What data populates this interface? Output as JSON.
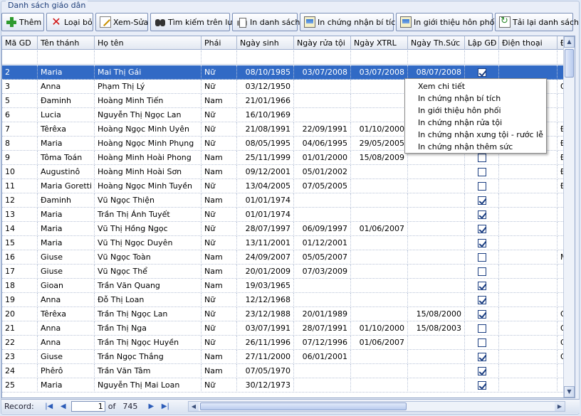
{
  "window": {
    "group_title": "Danh sách giáo dân"
  },
  "toolbar": {
    "buttons": [
      {
        "label": "Thêm",
        "icon": "plus-icon"
      },
      {
        "label": "Loại bỏ",
        "icon": "delete-x-icon"
      },
      {
        "label": "Xem-Sửa",
        "icon": "edit-icon"
      },
      {
        "label": "Tìm kiếm trên lưới",
        "icon": "binoculars-icon"
      },
      {
        "label": "In danh sách",
        "icon": "printer-icon"
      },
      {
        "label": "In chứng nhận bí tích",
        "icon": "certificate-icon"
      },
      {
        "label": "In giới thiệu hôn phối",
        "icon": "certificate-icon"
      },
      {
        "label": "Tải lại danh sách",
        "icon": "reload-icon"
      }
    ]
  },
  "grid": {
    "columns": [
      "Mã GD",
      "Tên thánh",
      "Họ tên",
      "Phái",
      "Ngày sinh",
      "Ngày rửa tội",
      "Ngày XTRL",
      "Ngày Th.Sức",
      "Lập GĐ",
      "Điện thoại",
      "Đ"
    ],
    "rows": [
      {
        "id": "2",
        "saint": "Maria",
        "name": "Mai Thị Gái",
        "sex": "Nữ",
        "dob": "08/10/1985",
        "baptism": "03/07/2008",
        "xtrl": "03/07/2008",
        "thsuc": "08/07/2008",
        "lapgd": true,
        "phone": "",
        "extra": "",
        "selected": true
      },
      {
        "id": "3",
        "saint": "Anna",
        "name": "Phạm Thị Lý",
        "sex": "Nữ",
        "dob": "03/12/1950",
        "baptism": "",
        "xtrl": "",
        "thsuc": "",
        "lapgd": false,
        "phone": "",
        "extra": "G"
      },
      {
        "id": "5",
        "saint": "Đaminh",
        "name": "Hoàng Minh Tiến",
        "sex": "Nam",
        "dob": "21/01/1966",
        "baptism": "",
        "xtrl": "",
        "thsuc": "",
        "lapgd": false,
        "phone": "",
        "extra": ""
      },
      {
        "id": "6",
        "saint": "Lucia",
        "name": "Nguyễn Thị Ngọc Lan",
        "sex": "Nữ",
        "dob": "16/10/1969",
        "baptism": "",
        "xtrl": "",
        "thsuc": "",
        "lapgd": false,
        "phone": "",
        "extra": ""
      },
      {
        "id": "7",
        "saint": "Têrêxa",
        "name": "Hoàng Ngọc Minh Uyên",
        "sex": "Nữ",
        "dob": "21/08/1991",
        "baptism": "22/09/1991",
        "xtrl": "01/10/2000",
        "thsuc": "",
        "lapgd": false,
        "phone": "",
        "extra": "Đ"
      },
      {
        "id": "8",
        "saint": "Maria",
        "name": "Hoàng Ngọc Minh Phụng",
        "sex": "Nữ",
        "dob": "08/05/1995",
        "baptism": "04/06/1995",
        "xtrl": "29/05/2005",
        "thsuc": "",
        "lapgd": false,
        "phone": "",
        "extra": "Đ"
      },
      {
        "id": "9",
        "saint": "Tôma Toán",
        "name": "Hoàng Minh Hoài Phong",
        "sex": "Nam",
        "dob": "25/11/1999",
        "baptism": "01/01/2000",
        "xtrl": "15/08/2009",
        "thsuc": "",
        "lapgd": false,
        "phone": "",
        "extra": "Đ"
      },
      {
        "id": "10",
        "saint": "Augustinô",
        "name": "Hoàng Minh Hoài Sơn",
        "sex": "Nam",
        "dob": "09/12/2001",
        "baptism": "05/01/2002",
        "xtrl": "",
        "thsuc": "",
        "lapgd": false,
        "phone": "",
        "extra": "Đ"
      },
      {
        "id": "11",
        "saint": "Maria Goretti",
        "name": "Hoàng Ngọc Minh Tuyền",
        "sex": "Nữ",
        "dob": "13/04/2005",
        "baptism": "07/05/2005",
        "xtrl": "",
        "thsuc": "",
        "lapgd": false,
        "phone": "",
        "extra": "Đ"
      },
      {
        "id": "12",
        "saint": "Đaminh",
        "name": "Vũ Ngọc Thiện",
        "sex": "Nam",
        "dob": "01/01/1974",
        "baptism": "",
        "xtrl": "",
        "thsuc": "",
        "lapgd": true,
        "phone": "",
        "extra": ""
      },
      {
        "id": "13",
        "saint": "Maria",
        "name": "Trần Thị Ánh Tuyết",
        "sex": "Nữ",
        "dob": "01/01/1974",
        "baptism": "",
        "xtrl": "",
        "thsuc": "",
        "lapgd": true,
        "phone": "",
        "extra": ""
      },
      {
        "id": "14",
        "saint": "Maria",
        "name": "Vũ Thị Hồng Ngọc",
        "sex": "Nữ",
        "dob": "28/07/1997",
        "baptism": "06/09/1997",
        "xtrl": "01/06/2007",
        "thsuc": "",
        "lapgd": true,
        "phone": "",
        "extra": ""
      },
      {
        "id": "15",
        "saint": "Maria",
        "name": "Vũ Thị Ngọc Duyên",
        "sex": "Nữ",
        "dob": "13/11/2001",
        "baptism": "01/12/2001",
        "xtrl": "",
        "thsuc": "",
        "lapgd": true,
        "phone": "",
        "extra": ""
      },
      {
        "id": "16",
        "saint": "Giuse",
        "name": "Vũ Ngọc Toàn",
        "sex": "Nam",
        "dob": "24/09/2007",
        "baptism": "05/05/2007",
        "xtrl": "",
        "thsuc": "",
        "lapgd": false,
        "phone": "",
        "extra": "M"
      },
      {
        "id": "17",
        "saint": "Giuse",
        "name": "Vũ Ngọc Thể",
        "sex": "Nam",
        "dob": "20/01/2009",
        "baptism": "07/03/2009",
        "xtrl": "",
        "thsuc": "",
        "lapgd": false,
        "phone": "",
        "extra": ""
      },
      {
        "id": "18",
        "saint": "Gioan",
        "name": "Trần Văn Quang",
        "sex": "Nam",
        "dob": "19/03/1965",
        "baptism": "",
        "xtrl": "",
        "thsuc": "",
        "lapgd": true,
        "phone": "",
        "extra": ""
      },
      {
        "id": "19",
        "saint": "Anna",
        "name": "Đỗ Thị Loan",
        "sex": "Nữ",
        "dob": "12/12/1968",
        "baptism": "",
        "xtrl": "",
        "thsuc": "",
        "lapgd": true,
        "phone": "",
        "extra": ""
      },
      {
        "id": "20",
        "saint": "Têrêxa",
        "name": "Trần Thị Ngọc Lan",
        "sex": "Nữ",
        "dob": "23/12/1988",
        "baptism": "20/01/1989",
        "xtrl": "",
        "thsuc": "15/08/2000",
        "lapgd": true,
        "phone": "",
        "extra": "G"
      },
      {
        "id": "21",
        "saint": "Anna",
        "name": "Trần Thị Nga",
        "sex": "Nữ",
        "dob": "03/07/1991",
        "baptism": "28/07/1991",
        "xtrl": "01/10/2000",
        "thsuc": "15/08/2003",
        "lapgd": false,
        "phone": "",
        "extra": "G"
      },
      {
        "id": "22",
        "saint": "Anna",
        "name": "Trần Thị Ngọc Huyền",
        "sex": "Nữ",
        "dob": "26/11/1996",
        "baptism": "07/12/1996",
        "xtrl": "01/06/2007",
        "thsuc": "",
        "lapgd": false,
        "phone": "",
        "extra": "G"
      },
      {
        "id": "23",
        "saint": "Giuse",
        "name": "Trần Ngọc Thắng",
        "sex": "Nam",
        "dob": "27/11/2000",
        "baptism": "06/01/2001",
        "xtrl": "",
        "thsuc": "",
        "lapgd": true,
        "phone": "",
        "extra": "G"
      },
      {
        "id": "24",
        "saint": "Phêrô",
        "name": "Trần Văn Tâm",
        "sex": "Nam",
        "dob": "07/05/1970",
        "baptism": "",
        "xtrl": "",
        "thsuc": "",
        "lapgd": true,
        "phone": "",
        "extra": ""
      },
      {
        "id": "25",
        "saint": "Maria",
        "name": "Nguyễn Thị Mai Loan",
        "sex": "Nữ",
        "dob": "30/12/1973",
        "baptism": "",
        "xtrl": "",
        "thsuc": "",
        "lapgd": true,
        "phone": "",
        "extra": ""
      }
    ]
  },
  "context_menu": {
    "items": [
      "Xem chi tiết",
      "In chứng nhận bí tích",
      "In giới thiệu hôn phối",
      "In chứng nhận rửa tội",
      "In chứng nhận xưng tội - rước lễ",
      "In chứng nhận thêm sức"
    ]
  },
  "footer": {
    "record_label": "Record:",
    "current": "1",
    "of_label": "of",
    "total": "745"
  },
  "colors": {
    "selection": "#316ac5",
    "accent": "#1c3f82"
  }
}
